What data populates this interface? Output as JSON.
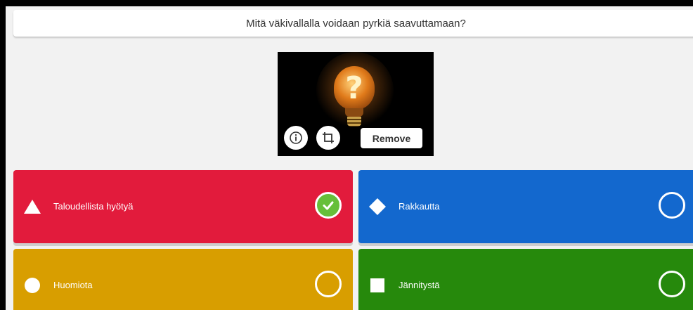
{
  "question": {
    "text": "Mitä väkivallalla voidaan pyrkiä saavuttamaan?"
  },
  "media": {
    "image_description_icon": "lightbulb-question-mark-image",
    "info_icon": "info-icon",
    "crop_icon": "crop-icon",
    "remove_label": "Remove"
  },
  "answers": [
    {
      "label": "Taloudellista hyötyä",
      "shape": "triangle",
      "color": "#e21b3c",
      "correct": true
    },
    {
      "label": "Rakkautta",
      "shape": "diamond",
      "color": "#1368ce",
      "correct": false
    },
    {
      "label": "Huomiota",
      "shape": "circle",
      "color": "#d89e00",
      "correct": false
    },
    {
      "label": "Jännitystä",
      "shape": "square",
      "color": "#26890c",
      "correct": false
    }
  ],
  "colors": {
    "correct_check": "#66bf39",
    "background": "#f2f2f2"
  }
}
